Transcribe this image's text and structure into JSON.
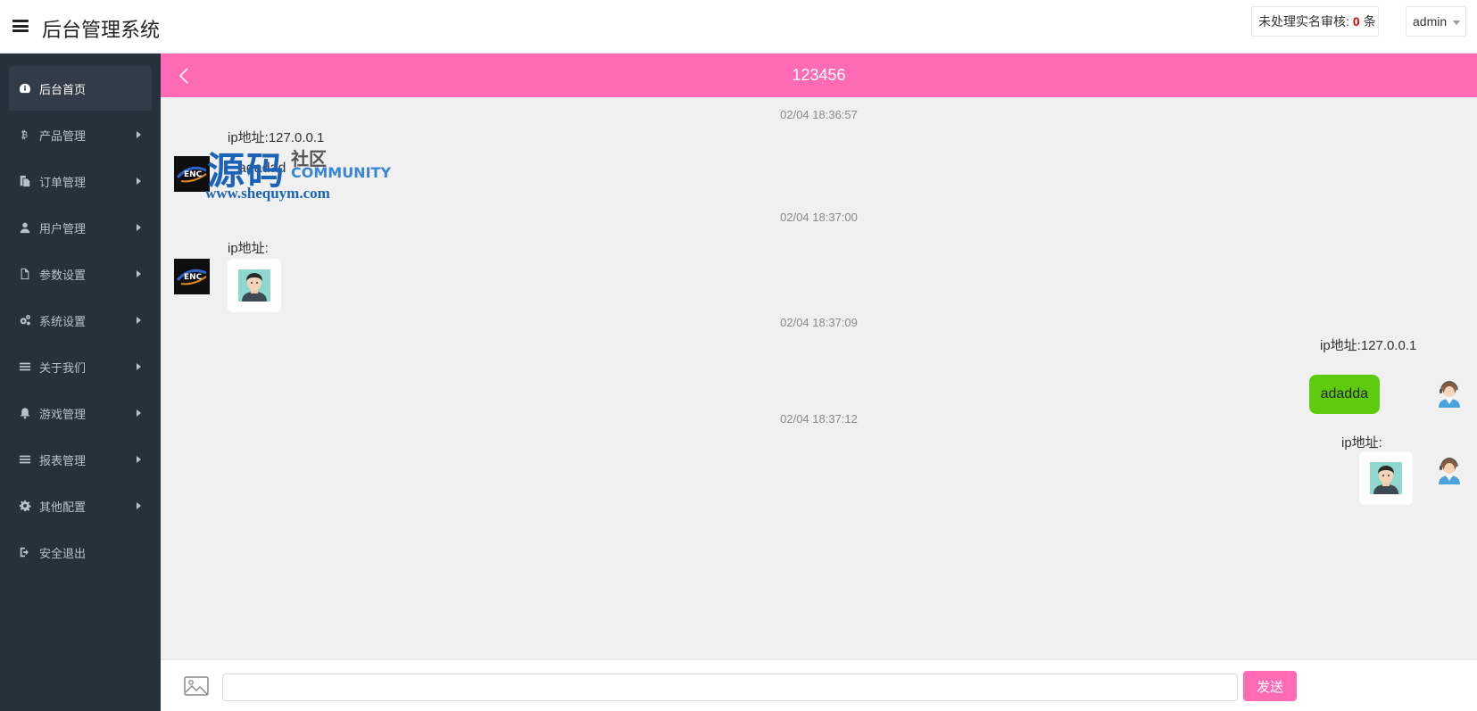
{
  "header": {
    "title": "后台管理系统",
    "pending_label": "未处理实名审核:",
    "pending_count": "0",
    "pending_unit": "条",
    "user": "admin"
  },
  "sidebar": {
    "items": [
      {
        "label": "后台首页",
        "icon": "dashboard-icon",
        "active": true
      },
      {
        "label": "产品管理",
        "icon": "bitcoin-icon"
      },
      {
        "label": "订单管理",
        "icon": "copy-icon"
      },
      {
        "label": "用户管理",
        "icon": "user-icon"
      },
      {
        "label": "参数设置",
        "icon": "file-icon"
      },
      {
        "label": "系统设置",
        "icon": "gears-icon"
      },
      {
        "label": "关于我们",
        "icon": "list-icon"
      },
      {
        "label": "游戏管理",
        "icon": "bell-icon"
      },
      {
        "label": "报表管理",
        "icon": "list-icon"
      },
      {
        "label": "其他配置",
        "icon": "gear-icon"
      },
      {
        "label": "安全退出",
        "icon": "sign-out-icon"
      }
    ]
  },
  "chat": {
    "title": "123456",
    "messages": [
      {
        "time": "02/04 18:36:57",
        "side": "left",
        "ip": "ip地址:127.0.0.1",
        "text": "adadad"
      },
      {
        "time": "02/04 18:37:00",
        "side": "left",
        "ip": "ip地址:",
        "image": "man-avatar-image"
      },
      {
        "time": "02/04 18:37:09",
        "side": "right",
        "ip": "ip地址:127.0.0.1",
        "text": "adadda"
      },
      {
        "time": "02/04 18:37:12",
        "side": "right",
        "ip": "ip地址:",
        "image": "man-avatar-image"
      }
    ]
  },
  "watermark": {
    "big": "源码",
    "small": "社区",
    "community": "COMMUNITY",
    "url": "www.shequym.com"
  },
  "input_bar": {
    "send_label": "发送",
    "input_value": ""
  },
  "colors": {
    "accent": "#ff6ab4",
    "sidebar_bg": "#27313c",
    "bubble_green": "#5fcb0f"
  }
}
